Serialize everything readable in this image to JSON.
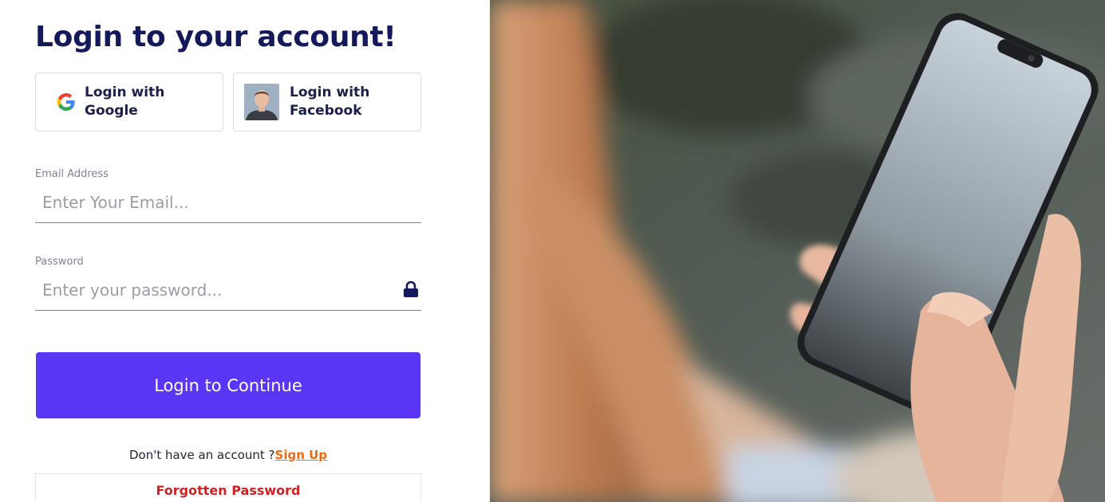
{
  "page": {
    "title": "Login to your account!"
  },
  "social": {
    "google_label": "Login with Google",
    "facebook_label": "Login with Facebook"
  },
  "form": {
    "email_label": "Email Address",
    "email_placeholder": "Enter Your Email...",
    "email_value": "",
    "password_label": "Password",
    "password_placeholder": "Enter your password...",
    "password_value": "",
    "submit_label": "Login to Continue"
  },
  "footer": {
    "no_account_text": "Don't have an account ?",
    "signup_link": "Sign Up",
    "forgot_label": "Forgotten Password"
  },
  "colors": {
    "title": "#13195a",
    "primary_button": "#5b35f5",
    "signup_link": "#ef6a10",
    "forgot_text": "#cf2222"
  },
  "icons": {
    "google": "google-icon",
    "facebook": "facebook-avatar",
    "lock": "lock-icon"
  }
}
